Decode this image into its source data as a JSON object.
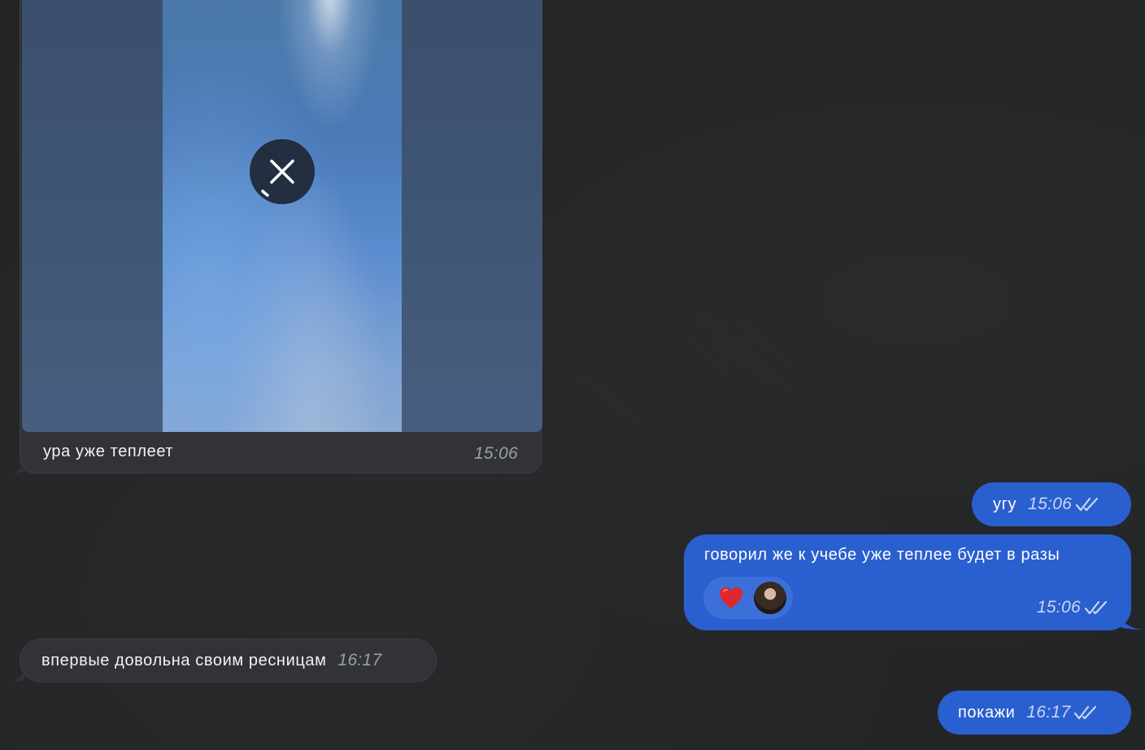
{
  "messages": {
    "media": {
      "caption": "ура уже теплеет",
      "time": "15:06",
      "cancel_icon": "close-icon"
    },
    "out_1": {
      "text": "угу",
      "time": "15:06",
      "status": "read"
    },
    "out_2": {
      "text": "говорил же к учебе уже теплее будет в разы",
      "time": "15:06",
      "status": "read",
      "reactions": [
        "heart-reaction",
        "reactor-avatar"
      ]
    },
    "in_1": {
      "text": "впервые довольна своим ресницам",
      "time": "16:17"
    },
    "out_3": {
      "text": "покажи",
      "time": "16:17",
      "status": "read"
    }
  },
  "colors": {
    "background": "#232527",
    "incoming_bubble": "#313336",
    "outgoing_bubble": "#2a5fcf",
    "reaction_pill": "#3c6fd8",
    "heart": "#e0262f"
  }
}
